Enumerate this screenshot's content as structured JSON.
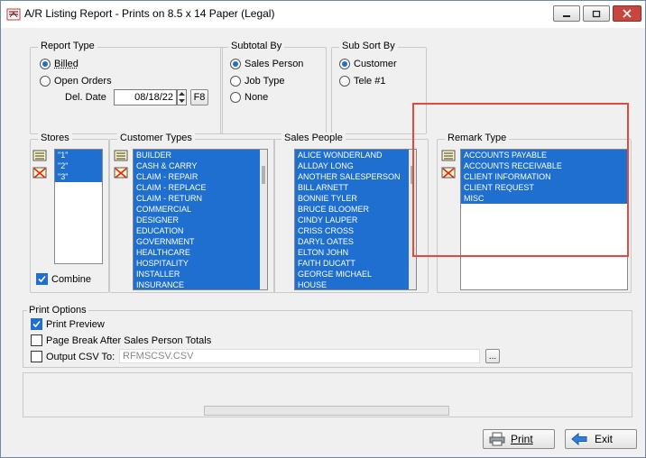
{
  "window": {
    "title": "A/R Listing Report - Prints on 8.5 x 14 Paper (Legal)"
  },
  "report_type": {
    "title": "Report Type",
    "options": [
      {
        "label": "Billed",
        "selected": true
      },
      {
        "label": "Open Orders",
        "selected": false
      }
    ],
    "del_date_label": "Del. Date",
    "del_date_value": "08/18/22",
    "f8_label": "F8"
  },
  "subtotal_by": {
    "title": "Subtotal By",
    "options": [
      {
        "label": "Sales Person",
        "selected": true
      },
      {
        "label": "Job Type",
        "selected": false
      },
      {
        "label": "None",
        "selected": false
      }
    ]
  },
  "sub_sort_by": {
    "title": "Sub Sort By",
    "options": [
      {
        "label": "Customer",
        "selected": true
      },
      {
        "label": "Tele #1",
        "selected": false
      }
    ]
  },
  "stores": {
    "title": "Stores",
    "items": [
      "\"1\"",
      "\"2\"",
      "\"3\""
    ],
    "combine_label": "Combine",
    "combine_checked": true
  },
  "customer_types": {
    "title": "Customer Types",
    "items": [
      "BUILDER",
      "CASH & CARRY",
      "CLAIM - REPAIR",
      "CLAIM - REPLACE",
      "CLAIM - RETURN",
      "COMMERCIAL",
      "DESIGNER",
      "EDUCATION",
      "GOVERNMENT",
      "HEALTHCARE",
      "HOSPITALITY",
      "INSTALLER",
      "INSURANCE"
    ]
  },
  "sales_people": {
    "title": "Sales People",
    "items": [
      "ALICE WONDERLAND",
      "ALLDAY LONG",
      "ANOTHER SALESPERSON",
      "BILL  ARNETT",
      "BONNIE TYLER",
      "BRUCE BLOOMER",
      "CINDY  LAUPER",
      "CRISS CROSS",
      "DARYL OATES",
      "ELTON JOHN",
      "FAITH DUCATT",
      "GEORGE MICHAEL",
      "HOUSE"
    ]
  },
  "remark_type": {
    "title": "Remark Type",
    "items": [
      "ACCOUNTS PAYABLE",
      "ACCOUNTS RECEIVABLE",
      "CLIENT INFORMATION",
      "CLIENT REQUEST",
      "MISC"
    ]
  },
  "print_options": {
    "title": "Print Options",
    "print_preview_label": "Print Preview",
    "print_preview_checked": true,
    "page_break_label": "Page Break After Sales Person Totals",
    "page_break_checked": false,
    "output_csv_label": "Output CSV To:",
    "output_csv_checked": false,
    "output_csv_value": "RFMSCSV.CSV",
    "browse_label": "..."
  },
  "buttons": {
    "print_label": "Print",
    "exit_label": "Exit"
  },
  "colors": {
    "selection": "#1f6fd0",
    "highlight_box": "#e04a3f"
  }
}
